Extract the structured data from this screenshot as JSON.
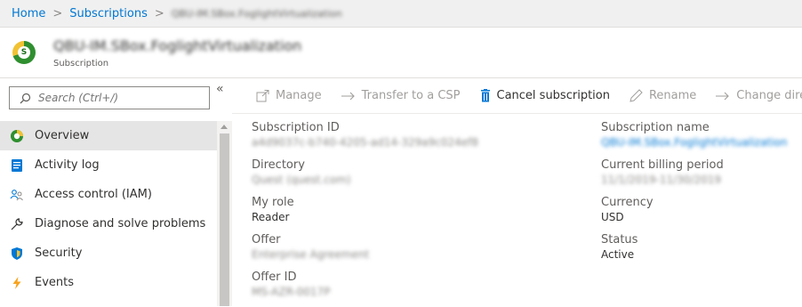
{
  "breadcrumb": {
    "home": "Home",
    "subscriptions": "Subscriptions",
    "current": "QBU-IM.SBox.FoglightVirtualization"
  },
  "header": {
    "title": "QBU-IM.SBox.FoglightVirtualization",
    "subtitle": "Subscription",
    "icon_letter": "S"
  },
  "search": {
    "placeholder": "Search (Ctrl+/)"
  },
  "collapse_label": "«",
  "nav": {
    "items": [
      {
        "label": "Overview",
        "icon": "overview-icon"
      },
      {
        "label": "Activity log",
        "icon": "activity-log-icon"
      },
      {
        "label": "Access control (IAM)",
        "icon": "people-icon"
      },
      {
        "label": "Diagnose and solve problems",
        "icon": "wrench-icon"
      },
      {
        "label": "Security",
        "icon": "shield-icon"
      },
      {
        "label": "Events",
        "icon": "lightning-icon"
      }
    ]
  },
  "toolbar": {
    "manage": "Manage",
    "transfer": "Transfer to a CSP",
    "cancel": "Cancel subscription",
    "rename": "Rename",
    "change_dir": "Change directory"
  },
  "properties": {
    "left": [
      {
        "label": "Subscription ID",
        "value": "a4d9037c-b740-4205-ad14-329a9c024ef8"
      },
      {
        "label": "Directory",
        "value": "Quest (quest.com)"
      },
      {
        "label": "My role",
        "value": "Reader"
      },
      {
        "label": "Offer",
        "value": "Enterprise Agreement"
      },
      {
        "label": "Offer ID",
        "value": "MS-AZR-0017P"
      }
    ],
    "right": [
      {
        "label": "Subscription name",
        "value": "QBU-IM.SBox.FoglightVirtualization"
      },
      {
        "label": "Current billing period",
        "value": "11/1/2019-11/30/2019"
      },
      {
        "label": "Currency",
        "value": "USD"
      },
      {
        "label": "Status",
        "value": "Active"
      }
    ]
  },
  "colors": {
    "accent": "#0078d4",
    "success": "#2f8f2f",
    "warning": "#f1c232"
  }
}
